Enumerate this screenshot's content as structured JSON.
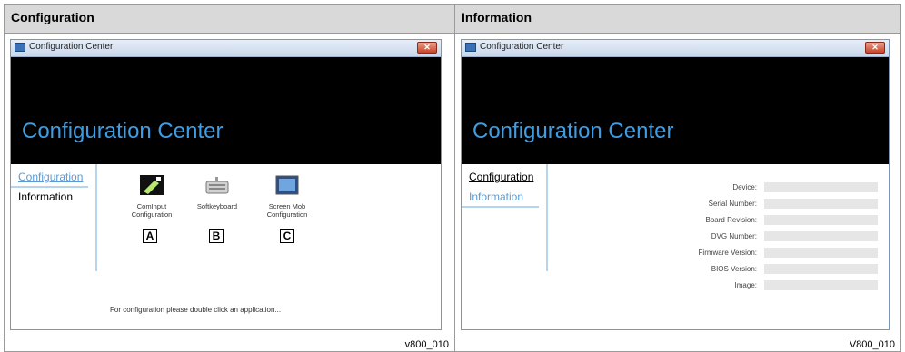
{
  "left": {
    "heading": "Configuration",
    "window_title": "Configuration Center",
    "banner_title": "Configuration Center",
    "nav": [
      "Configuration",
      "Information"
    ],
    "apps": [
      {
        "label": "ComInput Configuration",
        "icon": "cominput-icon",
        "letter": "A"
      },
      {
        "label": "Softkeyboard",
        "icon": "keyboard-icon",
        "letter": "B"
      },
      {
        "label": "Screen Mob Configuration",
        "icon": "screen-icon",
        "letter": "C"
      }
    ],
    "hint": "For configuration please double click an application...",
    "caption": "v800_010"
  },
  "right": {
    "heading": "Information",
    "window_title": "Configuration Center",
    "banner_title": "Configuration Center",
    "nav": [
      "Configuration",
      "Information"
    ],
    "fields": [
      "Device:",
      "Serial Number:",
      "Board Revision:",
      "DVG Number:",
      "Firmware Version:",
      "BIOS Version:",
      "Image:"
    ],
    "caption": "V800_010"
  },
  "colors": {
    "banner_text": "#3f9de3",
    "nav_active": "#5b9bd5",
    "header_bg": "#d9d9d9"
  }
}
